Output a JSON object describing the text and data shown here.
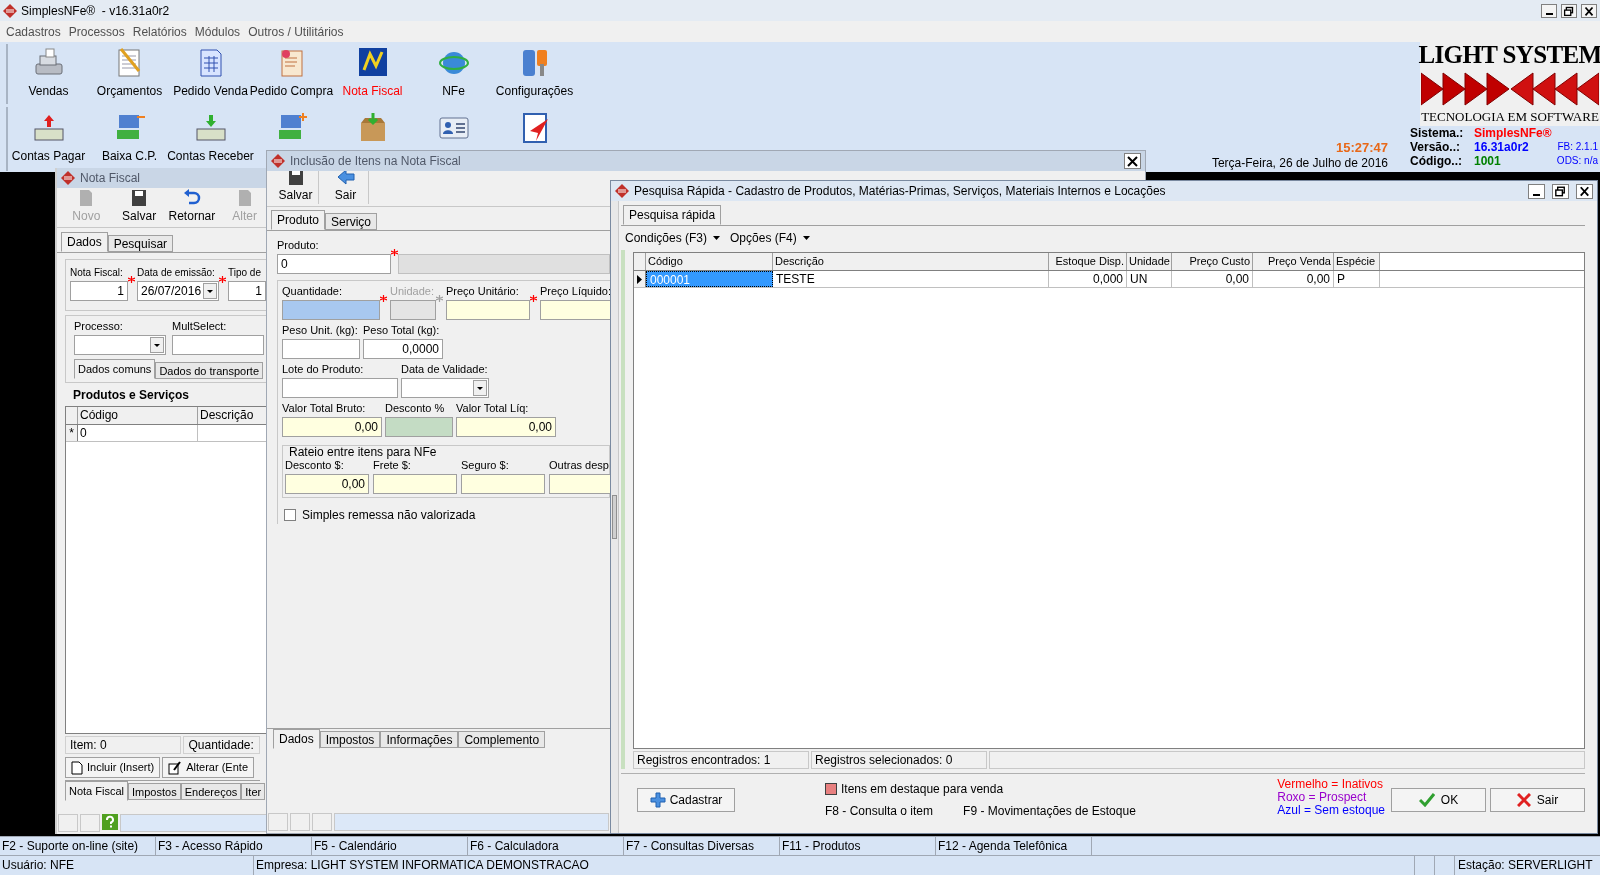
{
  "app": {
    "title": "SimplesNFe®  - v16.31a0r2"
  },
  "menu": [
    {
      "label": "Cadastros"
    },
    {
      "label": "Processos"
    },
    {
      "label": "Relatórios"
    },
    {
      "label": "Módulos"
    },
    {
      "label": "Outros / Utilitários"
    }
  ],
  "toolbar": {
    "row_1": [
      {
        "label": "Vendas",
        "active": false
      },
      {
        "label": "Orçamentos",
        "active": false
      },
      {
        "label": "Pedido Venda",
        "active": false
      },
      {
        "label": "Pedido Compra",
        "active": false
      },
      {
        "label": "Nota Fiscal",
        "active": true
      },
      {
        "label": "NFe",
        "active": false
      },
      {
        "label": "Configurações",
        "active": false
      }
    ],
    "row_2": [
      {
        "label": "Contas Pagar"
      },
      {
        "label": "Baixa C.P."
      },
      {
        "label": "Contas Receber"
      }
    ]
  },
  "logo": {
    "name": "LIGHT SYSTEM",
    "tagline": "TECNOLOGIA EM SOFTWARE"
  },
  "system_info": {
    "clock": "15:27:47",
    "date": "Terça-Feira, 26 de Julho de 2016",
    "rows": [
      {
        "label": "Sistema.:",
        "value": "SimplesNFe®",
        "color": "#ff0000"
      },
      {
        "label": "Versão..:",
        "value": "16.31a0r2",
        "color": "#0000ff",
        "note": "FB: 2.1.1"
      },
      {
        "label": "Código..:",
        "value": "1001",
        "color": "#008000",
        "note": "ODS: n/a"
      }
    ]
  },
  "nota_fiscal_window": {
    "title": "Nota Fiscal",
    "toolbar": [
      {
        "label": "Novo",
        "disabled": true
      },
      {
        "label": "Salvar",
        "disabled": false
      },
      {
        "label": "Retornar",
        "disabled": false
      },
      {
        "label": "Alter",
        "disabled": true
      }
    ],
    "tabs": [
      {
        "label": "Dados",
        "selected": true
      },
      {
        "label": "Pesquisar",
        "selected": false
      }
    ],
    "fields": [
      {
        "label": "Nota Fiscal:",
        "value": "1",
        "kind": "number",
        "required": true
      },
      {
        "label": "Data de emissão:",
        "value": "26/07/2016",
        "kind": "date",
        "required": true
      },
      {
        "label": "Tipo de",
        "value": "1",
        "kind": "number"
      }
    ],
    "fields_2": [
      {
        "label": "Processo:",
        "kind": "combo"
      },
      {
        "label": "MultSelect:",
        "kind": "text"
      }
    ],
    "subtabs": [
      {
        "label": "Dados comuns",
        "selected": true
      },
      {
        "label": "Dados do transporte",
        "selected": false
      }
    ],
    "group_title": "Produtos e Serviços",
    "grid": {
      "columns": [
        "Código",
        "Descrição"
      ],
      "new_row": {
        "marker": "*",
        "cells": [
          "0"
        ]
      }
    },
    "footer": [
      "Item: 0",
      "Quantidade:"
    ],
    "buttons": [
      {
        "label": "Incluir (Insert)",
        "kind": "new"
      },
      {
        "label": "Alterar (Ente",
        "kind": "edit"
      }
    ],
    "bottom_tabs": [
      {
        "label": "Nota Fiscal",
        "selected": true
      },
      {
        "label": "Impostos",
        "selected": false
      },
      {
        "label": "Endereços",
        "selected": false
      },
      {
        "label": "Iter",
        "selected": false
      }
    ]
  },
  "inclusao_window": {
    "title": "Inclusão de Itens na Nota Fiscal",
    "toolbar": [
      {
        "label": "Salvar",
        "kind": "save"
      },
      {
        "label": "Sair",
        "kind": "exit"
      }
    ],
    "tabs": [
      {
        "label": "Produto",
        "selected": true
      },
      {
        "label": "Serviço",
        "selected": false
      }
    ],
    "product": {
      "label": "Produto:",
      "value": "0",
      "required": true
    },
    "rows": [
      [
        {
          "label": "Quantidade:",
          "kind": "number",
          "required": true,
          "focused": true,
          "disabled": false
        },
        {
          "label": "Unidade:",
          "kind": "text",
          "required": true,
          "focused": false,
          "disabled": true
        },
        {
          "label": "Preço Unitário:",
          "kind": "money",
          "required": true,
          "focused": false,
          "disabled": false
        },
        {
          "label": "Preço Líquido:",
          "kind": "money",
          "focused": false,
          "disabled": false
        }
      ],
      [
        {
          "label": "Peso Unit. (kg):",
          "kind": "number",
          "focused": false,
          "disabled": false
        },
        {
          "label": "Peso Total (kg):",
          "value": "0,0000",
          "kind": "number",
          "focused": false,
          "disabled": false
        }
      ],
      [
        {
          "label": "Lote do Produto:",
          "kind": "text",
          "focused": false,
          "disabled": false
        },
        {
          "label": "Data de Validade:",
          "kind": "date",
          "focused": false,
          "disabled": false
        }
      ],
      [
        {
          "label": "Valor Total Bruto:",
          "value": "0,00",
          "kind": "money",
          "focused": false,
          "disabled": false
        },
        {
          "label": "Desconto %",
          "kind": "percent",
          "focused": false,
          "disabled": false
        },
        {
          "label": "Valor Total Líq:",
          "value": "0,00",
          "kind": "money",
          "focused": false,
          "disabled": false
        }
      ]
    ],
    "group": {
      "title": "Rateio entre itens para NFe",
      "fields": [
        {
          "label": "Desconto $:",
          "value": "0,00",
          "kind": "money"
        },
        {
          "label": "Frete $:",
          "kind": "money"
        },
        {
          "label": "Seguro $:",
          "kind": "money"
        },
        {
          "label": "Outras desp",
          "kind": "money"
        }
      ]
    },
    "checkbox": {
      "label": "Simples remessa não valorizada",
      "checked": false
    },
    "bottom_tabs": [
      {
        "label": "Dados",
        "selected": true
      },
      {
        "label": "Impostos",
        "selected": false
      },
      {
        "label": "Informações",
        "selected": false
      },
      {
        "label": "Complemento",
        "selected": false
      }
    ]
  },
  "pesquisa_window": {
    "title": "Pesquisa Rápida - Cadastro de Produtos, Matérias-Primas, Serviços, Materiais Internos e Locações",
    "tabs": [
      {
        "label": "Pesquisa rápida",
        "selected": true
      }
    ],
    "menus": [
      {
        "label": "Condições (F3)"
      },
      {
        "label": "Opções (F4)"
      }
    ],
    "table": {
      "columns": [
        "Código",
        "Descrição",
        "Estoque Disp.",
        "Unidade",
        "Preço Custo",
        "Preço Venda",
        "Espécie"
      ],
      "rows": [
        {
          "selected": true,
          "cells": [
            "000001",
            "TESTE",
            "0,000",
            "UN",
            "0,00",
            "0,00",
            "P"
          ]
        }
      ]
    },
    "status": [
      "Registros encontrados: 1",
      "Registros selecionados: 0"
    ],
    "register_button": "Cadastrar",
    "highlight_legend": {
      "label": "Itens em destaque para venda",
      "color": "#e88080"
    },
    "shortcuts": [
      "F8 - Consulta o item",
      "F9 - Movimentações de Estoque"
    ],
    "color_legend": [
      {
        "label": "Vermelho = Inativos",
        "color": "#ff0000"
      },
      {
        "label": "Roxo = Prospect",
        "color": "#9900cc"
      },
      {
        "label": "Azul = Sem estoque",
        "color": "#0000ff"
      }
    ],
    "buttons": [
      {
        "label": "OK",
        "kind": "ok"
      },
      {
        "label": "Sair",
        "kind": "cancel"
      }
    ]
  },
  "function_keys": [
    "F2 - Suporte on-line (site)",
    "F3 - Acesso Rápido",
    "F5 - Calendário",
    "F6 - Calculadora",
    "F7 - Consultas Diversas",
    "F11 - Produtos",
    "F12 - Agenda Telefônica"
  ],
  "status_bar": {
    "user": "Usuário: NFE",
    "company": "Empresa: LIGHT SYSTEM INFORMATICA DEMONSTRACAO",
    "station": "Estação: SERVERLIGHT"
  }
}
